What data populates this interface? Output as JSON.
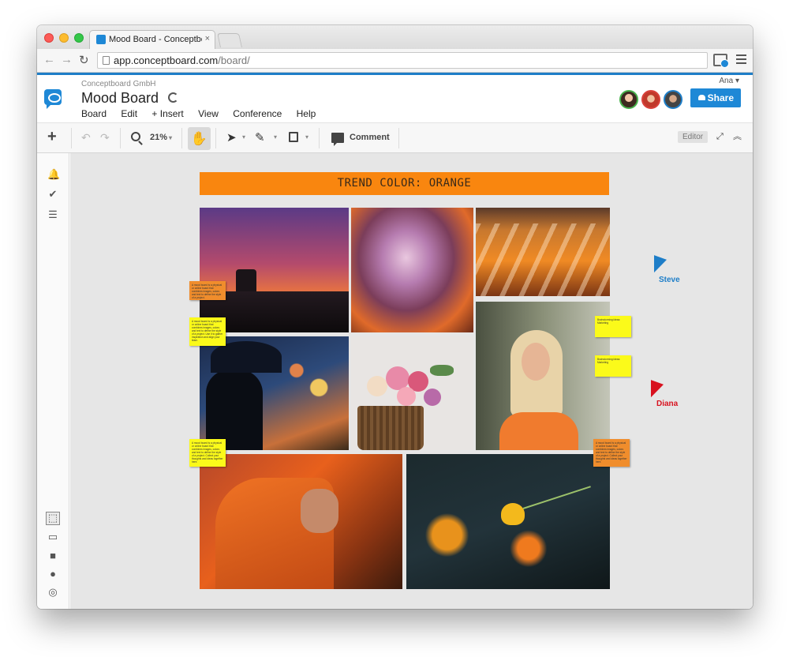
{
  "browser": {
    "tab_title": "Mood Board - Conceptboard",
    "tab_close": "×",
    "url_host": "app.conceptboard.com",
    "url_path": "/board/",
    "back_icon": "arrow-left-icon",
    "forward_icon": "arrow-right-icon",
    "reload_icon": "reload-icon"
  },
  "app": {
    "company": "Conceptboard GmbH",
    "board_title": "Mood Board",
    "user_name": "Ana",
    "user_caret": "▾",
    "menu": [
      "Board",
      "Edit",
      "+ Insert",
      "View",
      "Conference",
      "Help"
    ],
    "share_label": "Share",
    "accent_color": "#1e88d6"
  },
  "toolbar": {
    "add_glyph": "+",
    "undo_glyph": "↶",
    "redo_glyph": "↷",
    "zoom_value": "21%",
    "caret": "▾",
    "hand_glyph": "✋",
    "select_glyph": "➤",
    "pen_glyph": "✎",
    "comment_label": "Comment",
    "editor_label": "Editor",
    "fullscreen_glyph": "⤢",
    "collapse_glyph": "︽"
  },
  "rail": {
    "top": [
      "bell-icon",
      "check-circle-icon",
      "list-icon"
    ],
    "bottom": [
      "select-icon",
      "presentation-icon",
      "video-icon",
      "chat-icon",
      "compass-icon"
    ],
    "glyphs": {
      "bell": "🔔",
      "check": "✔",
      "list": "☰",
      "select": "⬚",
      "present": "▭",
      "video": "■",
      "chat": "●",
      "compass": "◎"
    }
  },
  "board": {
    "banner": "TREND COLOR: ORANGE",
    "banner_color": "#f9860f",
    "sticky_notes": [
      {
        "color": "orange",
        "text": "A mood board is a physical or online board that combines images, colors and text to define the style of a project."
      },
      {
        "color": "yellow",
        "text": "A mood board is a physical or online board that combines images, colors and text to define the style of a project. Use it to gather inspiration and align your team."
      },
      {
        "color": "yellow",
        "text": "Brainstorming ideas: Marketing"
      },
      {
        "color": "yellow",
        "text": "Brainstorming ideas: Marketing"
      },
      {
        "color": "yellow",
        "text": "A mood board is a physical or online board that combines images, colors and text to define the style of a project. Collect your thoughts and ideas together here."
      },
      {
        "color": "orange",
        "text": "A mood board is a physical or online board that combines images, colors and text to define the style of a project. Collect your thoughts and ideas together here."
      }
    ],
    "collaborators": [
      {
        "name": "Steve",
        "color": "#1e7ec8"
      },
      {
        "name": "Diana",
        "color": "#d8121f"
      }
    ]
  }
}
